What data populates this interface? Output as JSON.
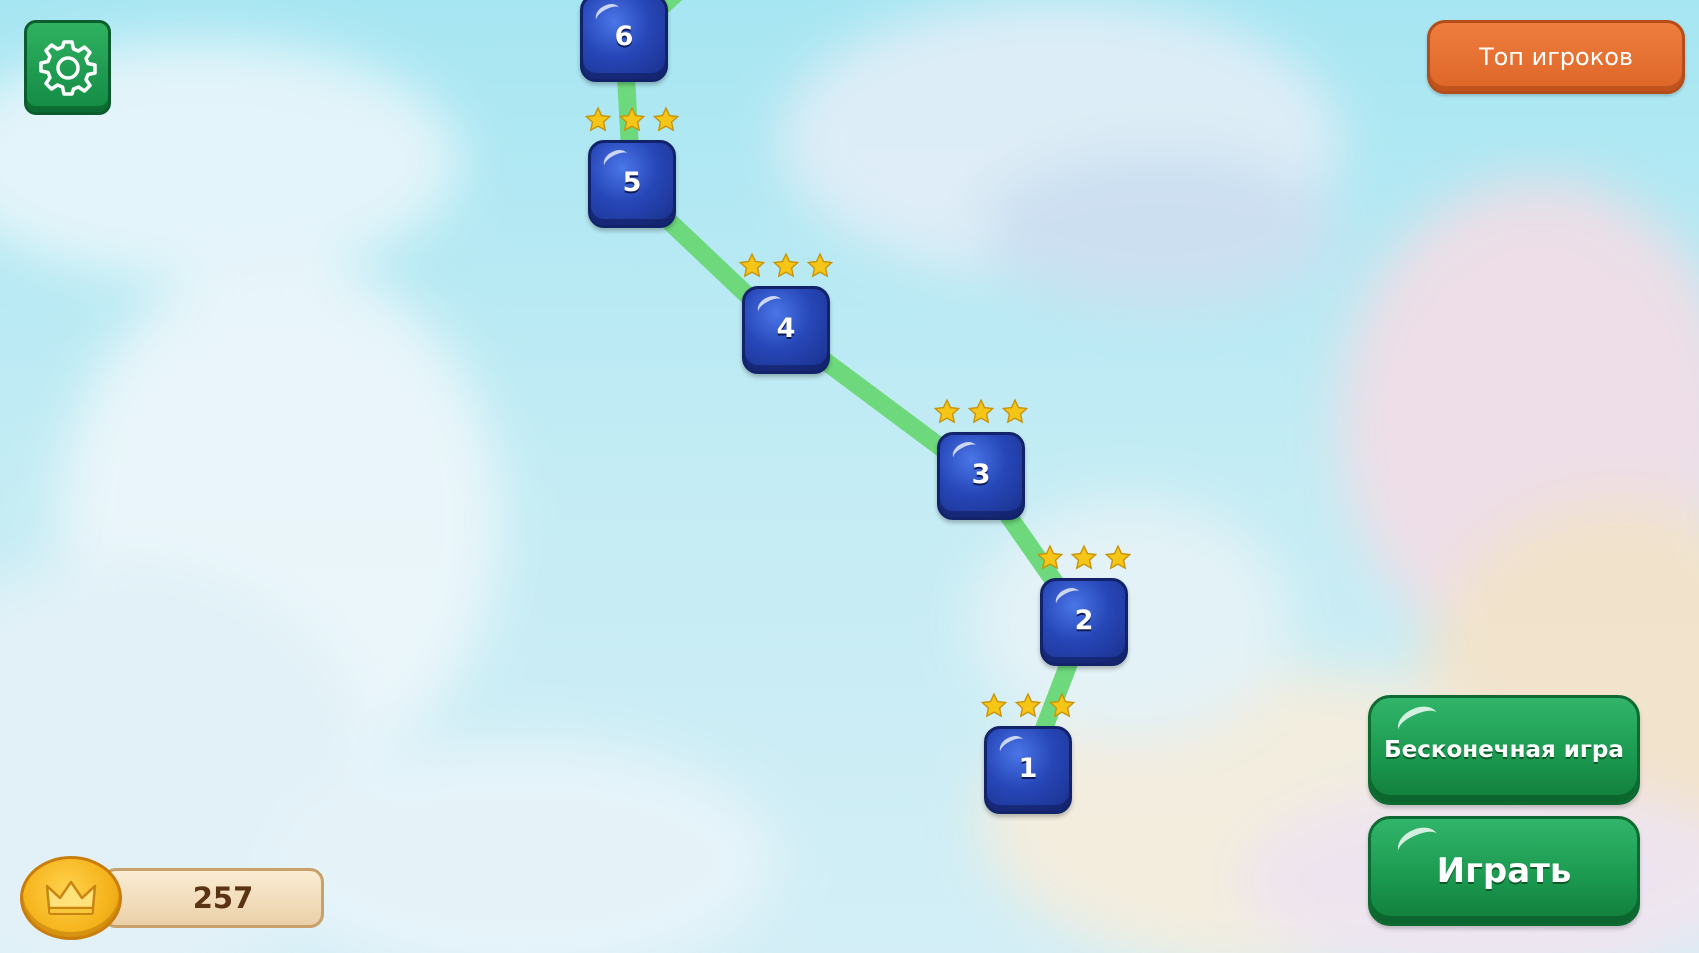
{
  "settings": {
    "icon": "gear-icon",
    "color": "#1d9a52"
  },
  "header": {
    "top_players_label": "Топ игроков",
    "top_players_color": "#e66f30"
  },
  "levels": [
    {
      "number": "1",
      "stars": 3
    },
    {
      "number": "2",
      "stars": 3
    },
    {
      "number": "3",
      "stars": 3
    },
    {
      "number": "4",
      "stars": 3
    },
    {
      "number": "5",
      "stars": 3
    },
    {
      "number": "6",
      "stars": 0
    }
  ],
  "actions": {
    "endless_label": "Бесконечная игра",
    "play_label": "Играть",
    "button_color": "#1f9e55"
  },
  "currency": {
    "icon": "crown-icon",
    "value": "257"
  },
  "colors": {
    "path": "#6dd97c",
    "level_tile": "#2a4bbd",
    "star": "#f5c518"
  }
}
